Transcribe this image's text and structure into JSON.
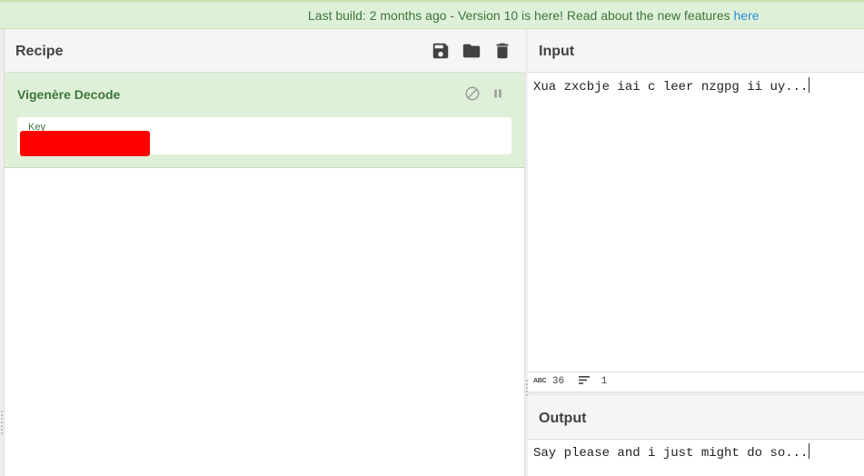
{
  "banner": {
    "prefix": "Last build: 2 months ago - Version 10 is here! Read about the new features ",
    "link": "here"
  },
  "recipe": {
    "title": "Recipe",
    "icons": [
      "save-icon",
      "folder-icon",
      "trash-icon"
    ],
    "operation": {
      "name": "Vigenère Decode",
      "key_label": "Key",
      "key_value": ""
    }
  },
  "input": {
    "title": "Input",
    "text": "Xua zxcbje iai c leer nzgpg ii uy...",
    "stats": {
      "chars": "36",
      "lines": "1"
    }
  },
  "output": {
    "title": "Output",
    "text": "Say please and i just might do so..."
  },
  "colors": {
    "banner_bg": "#dff0d8",
    "operation_bg": "#dff0d8",
    "operation_text": "#3c763d",
    "link": "#2a8fd3",
    "redaction": "#ff0000"
  }
}
